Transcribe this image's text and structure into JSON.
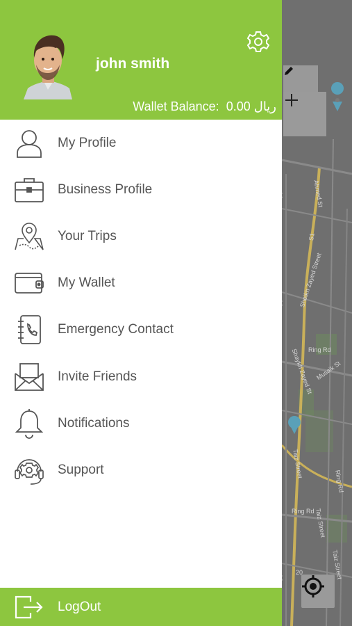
{
  "header": {
    "user_name": "john smith",
    "wallet_label": "Wallet Balance:",
    "wallet_value": "0.00 ريال",
    "settings_icon": "gear-icon",
    "avatar": "avatar-photo"
  },
  "menu": {
    "items": [
      {
        "label": "My Profile",
        "icon": "user-icon"
      },
      {
        "label": "Business Profile",
        "icon": "briefcase-icon"
      },
      {
        "label": "Your Trips",
        "icon": "map-pin-icon"
      },
      {
        "label": "My Wallet",
        "icon": "wallet-icon"
      },
      {
        "label": "Emergency Contact",
        "icon": "phone-book-icon"
      },
      {
        "label": "Invite Friends",
        "icon": "envelope-icon"
      },
      {
        "label": "Notifications",
        "icon": "bell-icon"
      },
      {
        "label": "Support",
        "icon": "support-headset-icon"
      }
    ]
  },
  "logout": {
    "label": "LogOut",
    "icon": "logout-icon"
  },
  "map": {
    "streets": [
      "Ahmed St",
      "S1",
      "Sheikh Zayed Street",
      "Ring Rd",
      "Shaykh Zayed St",
      "Musaik St",
      "Taiz Street",
      "Ring Rd",
      "Ring Rd",
      "Taiz Street",
      "Taiz Street",
      "A6",
      "A6",
      "20",
      "A8"
    ],
    "zoom_in_icon": "plus-icon",
    "edit_icon": "pencil-icon",
    "locate_icon": "crosshair-icon"
  },
  "colors": {
    "accent": "#8dc63f",
    "text": "#555555",
    "map_bg": "#6f6f6f"
  }
}
